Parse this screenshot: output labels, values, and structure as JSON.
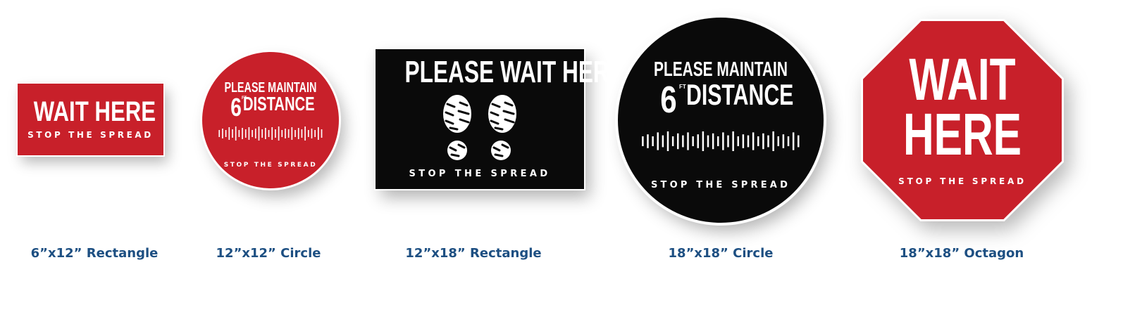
{
  "colors": {
    "red": "#c8202a",
    "black": "#0a0a0a",
    "caption": "#1d4f82"
  },
  "signs": [
    {
      "shape": "rectangle",
      "line1": "WAIT HERE",
      "line2": "STOP THE SPREAD",
      "caption": "6”x12” Rectangle"
    },
    {
      "shape": "circle",
      "line1": "PLEASE MAINTAIN",
      "six": "6",
      "ft": "FT",
      "distance": "DISTANCE",
      "line3": "STOP THE SPREAD",
      "caption": "12”x12” Circle"
    },
    {
      "shape": "rectangle",
      "line1": "PLEASE WAIT HERE",
      "icon": "footprints-icon",
      "line3": "STOP THE SPREAD",
      "caption": "12”x18” Rectangle"
    },
    {
      "shape": "circle",
      "line1": "PLEASE MAINTAIN",
      "six": "6",
      "ft": "FT",
      "distance": "DISTANCE",
      "line3": "STOP THE SPREAD",
      "caption": "18”x18” Circle"
    },
    {
      "shape": "octagon",
      "line1": "WAIT",
      "line2": "HERE",
      "line3": "STOP THE SPREAD",
      "caption": "18”x18” Octagon"
    }
  ]
}
